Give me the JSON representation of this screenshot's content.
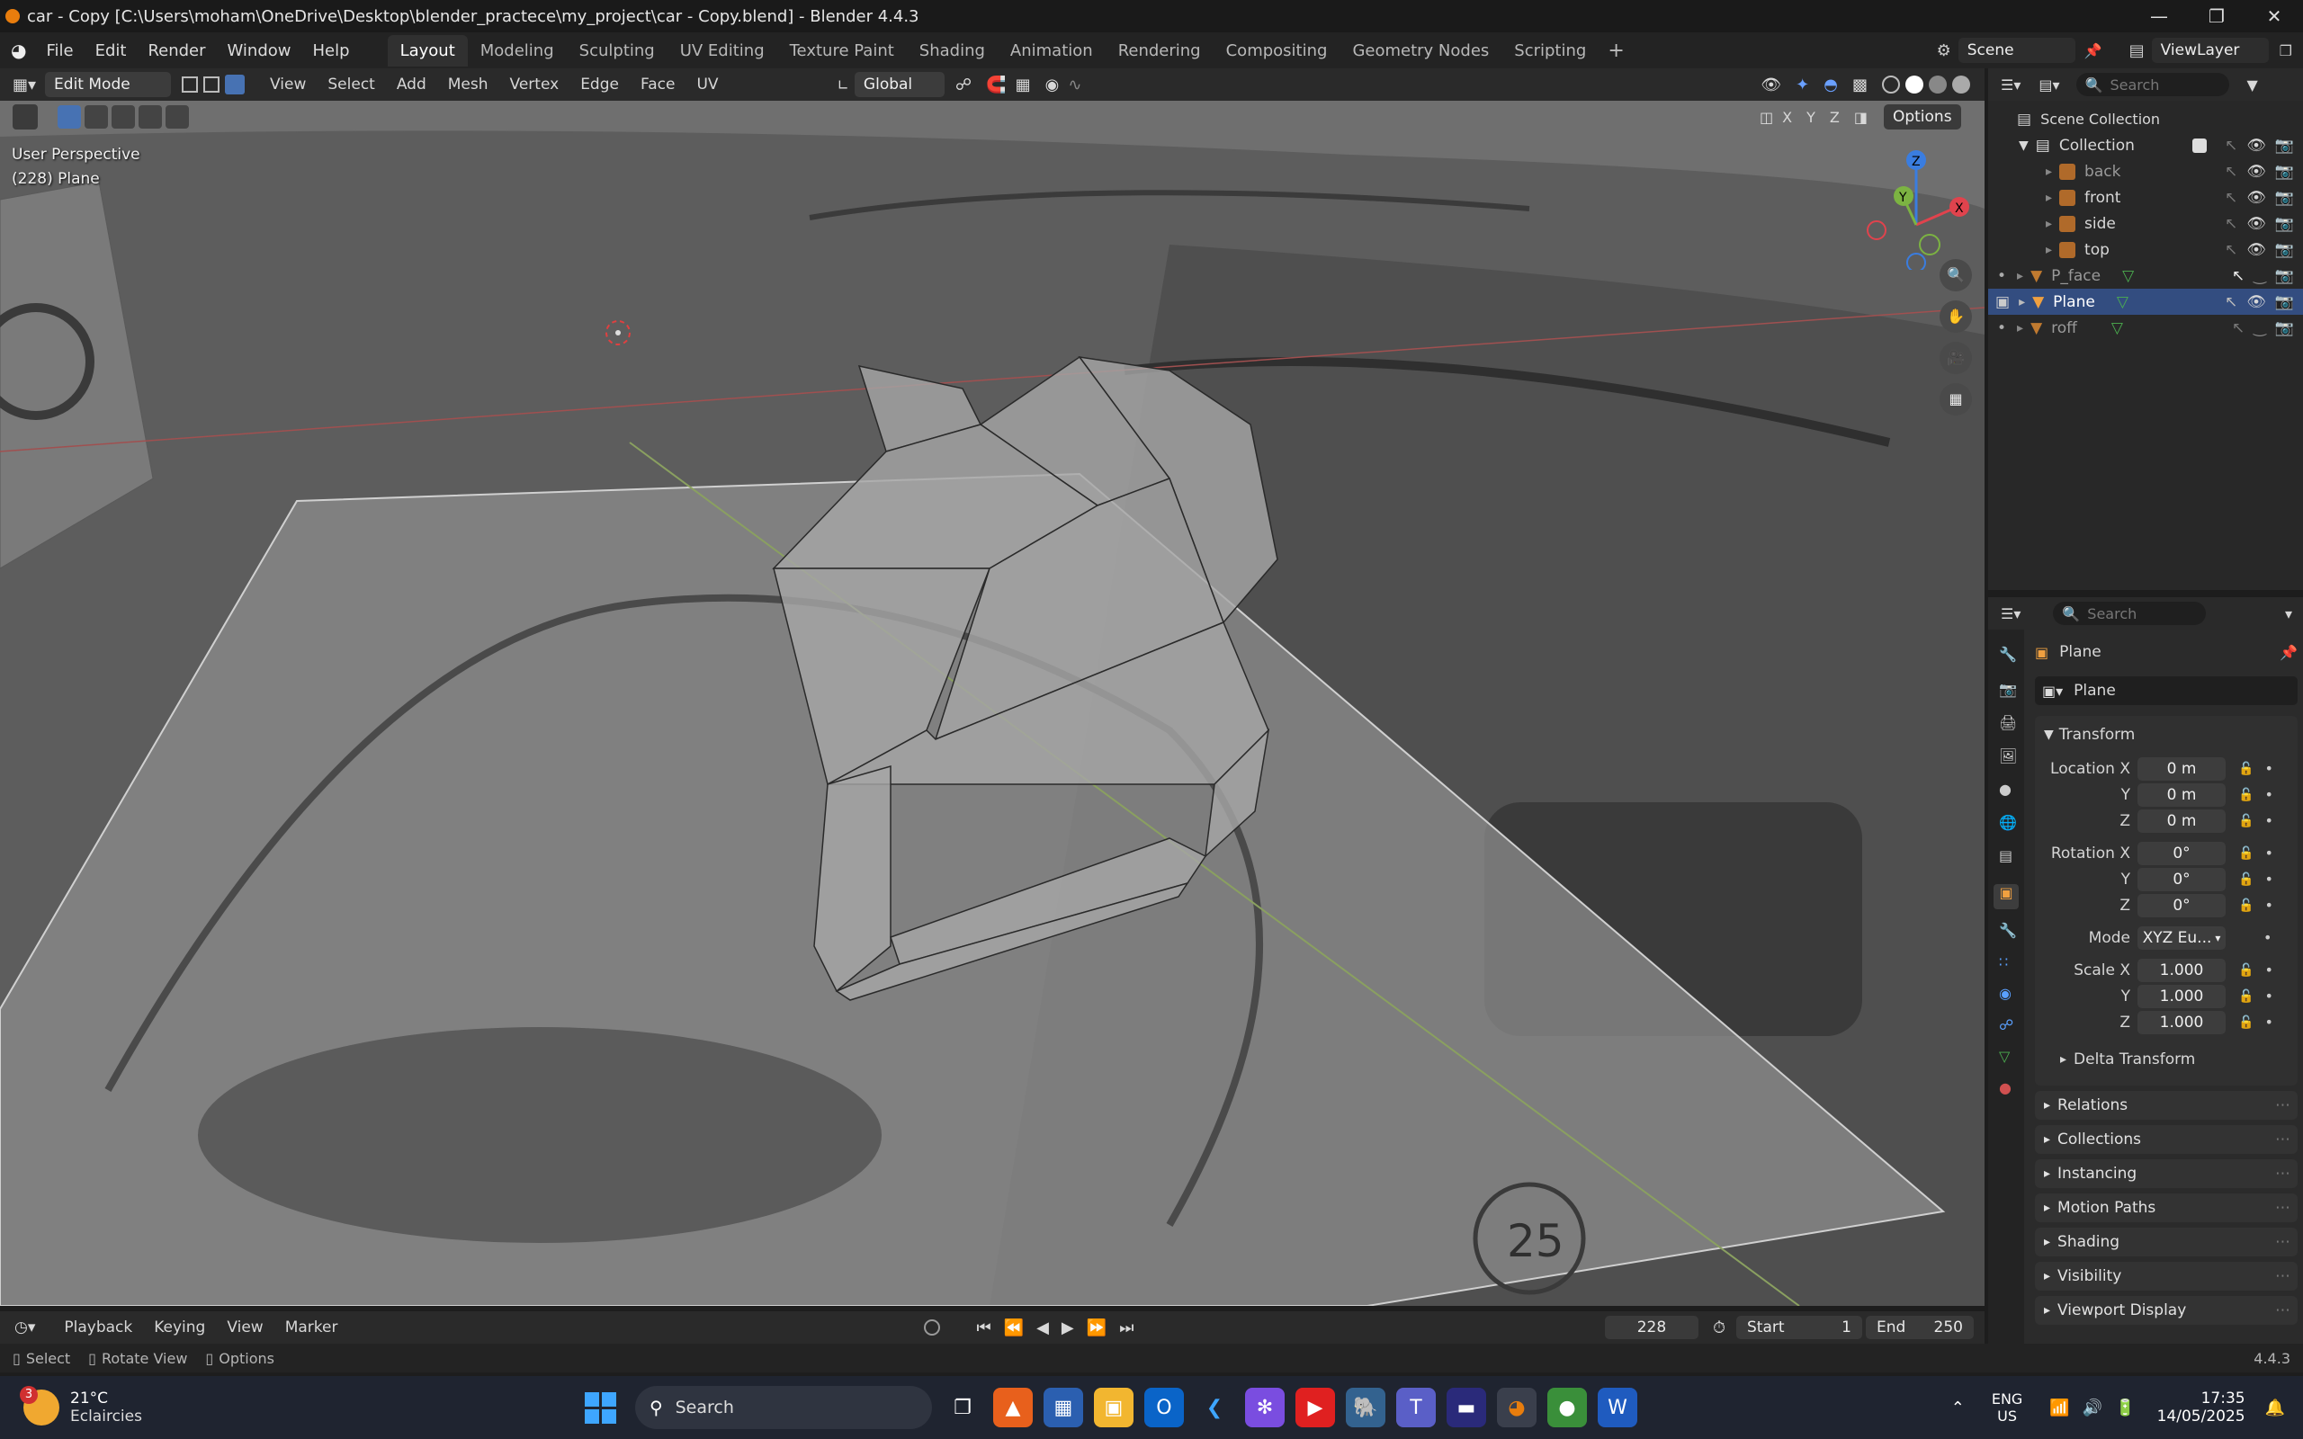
{
  "window": {
    "title": "car - Copy [C:\\Users\\moham\\OneDrive\\Desktop\\blender_practece\\my_project\\car - Copy.blend] - Blender 4.4.3"
  },
  "menubar": {
    "menus": [
      "File",
      "Edit",
      "Render",
      "Window",
      "Help"
    ],
    "workspaces": [
      "Layout",
      "Modeling",
      "Sculpting",
      "UV Editing",
      "Texture Paint",
      "Shading",
      "Animation",
      "Rendering",
      "Compositing",
      "Geometry Nodes",
      "Scripting"
    ],
    "active_workspace": "Layout",
    "scene": "Scene",
    "view_layer": "ViewLayer"
  },
  "viewport_header": {
    "mode": "Edit Mode",
    "menus": [
      "View",
      "Select",
      "Add",
      "Mesh",
      "Vertex",
      "Edge",
      "Face",
      "UV"
    ],
    "orientation": "Global",
    "options": "Options",
    "axes": [
      "X",
      "Y",
      "Z"
    ]
  },
  "viewport": {
    "perspective": "User Perspective",
    "object_info": "(228) Plane",
    "gizmo_axes": [
      "Z",
      "Y",
      "X"
    ]
  },
  "timeline": {
    "menus": [
      "Playback",
      "Keying",
      "View",
      "Marker"
    ],
    "current_frame": "228",
    "start_label": "Start",
    "start": "1",
    "end_label": "End",
    "end": "250"
  },
  "statusbar": {
    "hints": [
      "Select",
      "Rotate View",
      "Options"
    ],
    "version": "4.4.3"
  },
  "outliner": {
    "search_placeholder": "Search",
    "root": "Scene Collection",
    "collection": "Collection",
    "children": [
      "back",
      "front",
      "side",
      "top"
    ],
    "objects": [
      "P_face",
      "Plane",
      "roff"
    ]
  },
  "properties": {
    "search_placeholder": "Search",
    "object_name": "Plane",
    "data_name": "Plane",
    "transform_label": "Transform",
    "location_label": "Location X",
    "rotation_label": "Rotation X",
    "scale_label": "Scale X",
    "axis_y": "Y",
    "axis_z": "Z",
    "location": [
      "0 m",
      "0 m",
      "0 m"
    ],
    "rotation": [
      "0°",
      "0°",
      "0°"
    ],
    "mode_label": "Mode",
    "mode": "XYZ Eu...",
    "scale": [
      "1.000",
      "1.000",
      "1.000"
    ],
    "delta": "Delta Transform",
    "panels": [
      "Relations",
      "Collections",
      "Instancing",
      "Motion Paths",
      "Shading",
      "Visibility",
      "Viewport Display"
    ]
  },
  "taskbar": {
    "weather_temp": "21°C",
    "weather_desc": "Eclaircies",
    "weather_badge": "3",
    "search": "Search",
    "lang": "ENG",
    "region": "US",
    "time": "17:35",
    "date": "14/05/2025"
  },
  "colors": {
    "accent_blue": "#4772b3",
    "axis_x": "#e0434d",
    "axis_y": "#7cb342",
    "axis_z": "#3a7de0",
    "object_orange": "#e8a234"
  }
}
